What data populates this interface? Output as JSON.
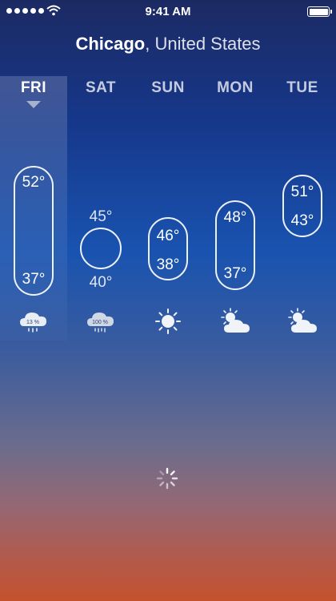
{
  "status_bar": {
    "time": "9:41 AM",
    "signal_bars": 5
  },
  "location": {
    "city": "Chicago",
    "country": "United States"
  },
  "forecast": [
    {
      "day": "FRI",
      "high": "52°",
      "low": "37°",
      "icon": "rain-cloud-icon",
      "precip": "13 %",
      "selected": true
    },
    {
      "day": "SAT",
      "high": "45°",
      "low": "40°",
      "icon": "rain-cloud-icon",
      "precip": "100 %",
      "selected": false
    },
    {
      "day": "SUN",
      "high": "46°",
      "low": "38°",
      "icon": "sun-icon",
      "selected": false
    },
    {
      "day": "MON",
      "high": "48°",
      "low": "37°",
      "icon": "partly-cloudy-icon",
      "selected": false
    },
    {
      "day": "TUE",
      "high": "51°",
      "low": "43°",
      "icon": "partly-cloudy-icon",
      "selected": false
    }
  ]
}
